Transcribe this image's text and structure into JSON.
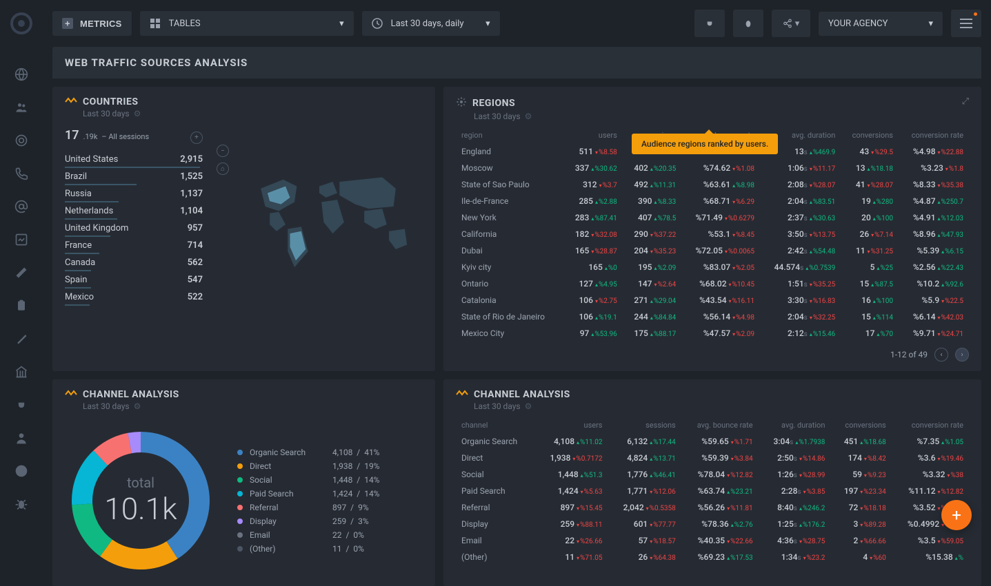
{
  "topbar": {
    "metrics": "METRICS",
    "tables": "TABLES",
    "daterange": "Last 30 days, daily",
    "agency": "YOUR AGENCY"
  },
  "title": "WEB TRAFFIC SOURCES ANALYSIS",
  "tooltip": "Audience regions ranked by users.",
  "countries": {
    "title": "COUNTRIES",
    "sub": "Last 30 days",
    "total_big": "17",
    "total_sm": ".19k",
    "total_label": "– All sessions",
    "rows": [
      {
        "name": "United States",
        "val": "2,915",
        "w": "98%"
      },
      {
        "name": "Brazil",
        "val": "1,525",
        "w": "52%"
      },
      {
        "name": "Russia",
        "val": "1,137",
        "w": "39%"
      },
      {
        "name": "Netherlands",
        "val": "1,104",
        "w": "38%"
      },
      {
        "name": "United Kingdom",
        "val": "957",
        "w": "33%"
      },
      {
        "name": "France",
        "val": "714",
        "w": "25%"
      },
      {
        "name": "Canada",
        "val": "562",
        "w": "19%"
      },
      {
        "name": "Spain",
        "val": "547",
        "w": "19%"
      },
      {
        "name": "Mexico",
        "val": "522",
        "w": "18%"
      }
    ]
  },
  "regions": {
    "title": "REGIONS",
    "sub": "Last 30 days",
    "headers": [
      "region",
      "users",
      "sessions",
      "bounce rate",
      "avg. duration",
      "conversions",
      "conversion rate"
    ],
    "rows": [
      {
        "name": "England",
        "users": "511",
        "ud": "%8.58",
        "udir": "down",
        "sess": "",
        "sd": "",
        "sdir": "",
        "br": "",
        "brd": "",
        "brdir": "",
        "dur": "13",
        "durs": "s",
        "durd": "%469.9",
        "durdir": "up",
        "conv": "43",
        "convd": "%29.5",
        "convdir": "down",
        "cr": "%4.98",
        "crd": "%22.88",
        "crdir": "down"
      },
      {
        "name": "Moscow",
        "users": "337",
        "ud": "%30.62",
        "udir": "up",
        "sess": "402",
        "sd": "%20.35",
        "sdir": "up",
        "br": "%74.62",
        "brd": "%1.08",
        "brdir": "down",
        "dur": "1:06",
        "durs": "s",
        "durd": "%11.17",
        "durdir": "down",
        "conv": "13",
        "convd": "%18.18",
        "convdir": "up",
        "cr": "%3.23",
        "crd": "%1.8",
        "crdir": "down"
      },
      {
        "name": "State of Sao Paulo",
        "users": "312",
        "ud": "%3.7",
        "udir": "down",
        "sess": "492",
        "sd": "%11.31",
        "sdir": "up",
        "br": "%63.61",
        "brd": "%8.98",
        "brdir": "up",
        "dur": "2:08",
        "durs": "s",
        "durd": "%28.07",
        "durdir": "down",
        "conv": "41",
        "convd": "%28.07",
        "convdir": "down",
        "cr": "%8.33",
        "crd": "%35.38",
        "crdir": "down"
      },
      {
        "name": "Ile-de-France",
        "users": "285",
        "ud": "%2.88",
        "udir": "up",
        "sess": "390",
        "sd": "%8.33",
        "sdir": "up",
        "br": "%68.71",
        "brd": "%6.29",
        "brdir": "down",
        "dur": "2:04",
        "durs": "s",
        "durd": "%83.51",
        "durdir": "up",
        "conv": "19",
        "convd": "%280",
        "convdir": "up",
        "cr": "%4.87",
        "crd": "%250.7",
        "crdir": "up"
      },
      {
        "name": "New York",
        "users": "283",
        "ud": "%87.41",
        "udir": "up",
        "sess": "407",
        "sd": "%78.5",
        "sdir": "up",
        "br": "%71.49",
        "brd": "%0.6279",
        "brdir": "down",
        "dur": "2:37",
        "durs": "s",
        "durd": "%30.63",
        "durdir": "up",
        "conv": "20",
        "convd": "%100",
        "convdir": "up",
        "cr": "%4.91",
        "crd": "%12.03",
        "crdir": "up"
      },
      {
        "name": "California",
        "users": "182",
        "ud": "%32.08",
        "udir": "down",
        "sess": "290",
        "sd": "%37.22",
        "sdir": "down",
        "br": "%53.1",
        "brd": "%8.45",
        "brdir": "down",
        "dur": "3:50",
        "durs": "s",
        "durd": "%13.75",
        "durdir": "down",
        "conv": "26",
        "convd": "%7.14",
        "convdir": "down",
        "cr": "%8.96",
        "crd": "%47.93",
        "crdir": "up"
      },
      {
        "name": "Dubai",
        "users": "165",
        "ud": "%28.87",
        "udir": "down",
        "sess": "204",
        "sd": "%35.23",
        "sdir": "down",
        "br": "%72.05",
        "brd": "%0.0065",
        "brdir": "down",
        "dur": "2:42",
        "durs": "s",
        "durd": "%54.48",
        "durdir": "up",
        "conv": "11",
        "convd": "%31.25",
        "convdir": "down",
        "cr": "%5.39",
        "crd": "%6.15",
        "crdir": "up"
      },
      {
        "name": "Kyiv city",
        "users": "165",
        "ud": "%0",
        "udir": "up",
        "sess": "195",
        "sd": "%2.09",
        "sdir": "up",
        "br": "%83.07",
        "brd": "%2.05",
        "brdir": "down",
        "dur": "44.574",
        "durs": "s",
        "durd": "%0.7539",
        "durdir": "up",
        "conv": "5",
        "convd": "%25",
        "convdir": "up",
        "cr": "%2.56",
        "crd": "%22.43",
        "crdir": "up"
      },
      {
        "name": "Ontario",
        "users": "127",
        "ud": "%4.95",
        "udir": "up",
        "sess": "147",
        "sd": "%2.64",
        "sdir": "down",
        "br": "%68.02",
        "brd": "%10.45",
        "brdir": "down",
        "dur": "1:51",
        "durs": "s",
        "durd": "%35.25",
        "durdir": "down",
        "conv": "15",
        "convd": "%87.5",
        "convdir": "up",
        "cr": "%10.2",
        "crd": "%92.6",
        "crdir": "up"
      },
      {
        "name": "Catalonia",
        "users": "106",
        "ud": "%2.75",
        "udir": "down",
        "sess": "271",
        "sd": "%29.04",
        "sdir": "up",
        "br": "%43.54",
        "brd": "%16.11",
        "brdir": "down",
        "dur": "3:30",
        "durs": "s",
        "durd": "%16.83",
        "durdir": "down",
        "conv": "16",
        "convd": "%100",
        "convdir": "up",
        "cr": "%5.9",
        "crd": "%22.5",
        "crdir": "down"
      },
      {
        "name": "State of Rio de Janeiro",
        "users": "106",
        "ud": "%19.1",
        "udir": "up",
        "sess": "244",
        "sd": "%84.84",
        "sdir": "up",
        "br": "%56.14",
        "brd": "%4.98",
        "brdir": "down",
        "dur": "2:04",
        "durs": "s",
        "durd": "%32.25",
        "durdir": "down",
        "conv": "15",
        "convd": "%114",
        "convdir": "up",
        "cr": "%6.14",
        "crd": "%42.03",
        "crdir": "down"
      },
      {
        "name": "Mexico City",
        "users": "97",
        "ud": "%53.96",
        "udir": "up",
        "sess": "175",
        "sd": "%88.17",
        "sdir": "up",
        "br": "%47.57",
        "brd": "%2.09",
        "brdir": "down",
        "dur": "2:12",
        "durs": "s",
        "durd": "%15.46",
        "durdir": "up",
        "conv": "17",
        "convd": "%70",
        "convdir": "up",
        "cr": "%9.71",
        "crd": "%24.71",
        "crdir": "down"
      }
    ],
    "pagination": "1-12 of 49"
  },
  "channel_donut": {
    "title": "CHANNEL ANALYSIS",
    "sub": "Last 30 days",
    "total_label": "total",
    "total": "10.1k",
    "legend": [
      {
        "name": "Organic Search",
        "val": "4,108",
        "pct": "41%",
        "color": "#3b82c4"
      },
      {
        "name": "Direct",
        "val": "1,938",
        "pct": "19%",
        "color": "#f59e0b"
      },
      {
        "name": "Social",
        "val": "1,448",
        "pct": "14%",
        "color": "#10b981"
      },
      {
        "name": "Paid Search",
        "val": "1,424",
        "pct": "14%",
        "color": "#06b6d4"
      },
      {
        "name": "Referral",
        "val": "897",
        "pct": "9%",
        "color": "#f87171"
      },
      {
        "name": "Display",
        "val": "259",
        "pct": "3%",
        "color": "#a78bfa"
      },
      {
        "name": "Email",
        "val": "22",
        "pct": "0%",
        "color": "#6b7280"
      },
      {
        "name": "(Other)",
        "val": "11",
        "pct": "0%",
        "color": "#4b5563"
      }
    ]
  },
  "channel_table": {
    "title": "CHANNEL ANALYSIS",
    "sub": "Last 30 days",
    "headers": [
      "channel",
      "users",
      "sessions",
      "avg. bounce rate",
      "avg. duration",
      "conversions",
      "conversion rate"
    ],
    "rows": [
      {
        "name": "Organic Search",
        "users": "4,108",
        "ud": "%11.02",
        "udir": "up",
        "sess": "6,132",
        "sd": "%17.44",
        "sdir": "up",
        "br": "%59.65",
        "brd": "%1.71",
        "brdir": "down",
        "dur": "3:04",
        "durs": "s",
        "durd": "%1.7938",
        "durdir": "up",
        "conv": "451",
        "convd": "%18.68",
        "convdir": "up",
        "cr": "%7.35",
        "crd": "%1.05",
        "crdir": "up"
      },
      {
        "name": "Direct",
        "users": "1,938",
        "ud": "%0.7172",
        "udir": "down",
        "sess": "4,824",
        "sd": "%13.71",
        "sdir": "up",
        "br": "%59.39",
        "brd": "%3.84",
        "brdir": "down",
        "dur": "2:50",
        "durs": "s",
        "durd": "%14.86",
        "durdir": "down",
        "conv": "174",
        "convd": "%8.42",
        "convdir": "down",
        "cr": "%3.6",
        "crd": "%19.46",
        "crdir": "down"
      },
      {
        "name": "Social",
        "users": "1,448",
        "ud": "%51.3",
        "udir": "up",
        "sess": "1,776",
        "sd": "%46.41",
        "sdir": "up",
        "br": "%78.04",
        "brd": "%12.82",
        "brdir": "down",
        "dur": "1:26",
        "durs": "s",
        "durd": "%28.99",
        "durdir": "down",
        "conv": "59",
        "convd": "%9.23",
        "convdir": "down",
        "cr": "%3.32",
        "crd": "%38",
        "crdir": "down"
      },
      {
        "name": "Paid Search",
        "users": "1,424",
        "ud": "%5.63",
        "udir": "down",
        "sess": "1,771",
        "sd": "%12.06",
        "sdir": "down",
        "br": "%63.74",
        "brd": "%23.21",
        "brdir": "up",
        "dur": "2:28",
        "durs": "s",
        "durd": "%3.85",
        "durdir": "down",
        "conv": "197",
        "convd": "%23.34",
        "convdir": "down",
        "cr": "%11.12",
        "crd": "%12.82",
        "crdir": "down"
      },
      {
        "name": "Referral",
        "users": "897",
        "ud": "%15.45",
        "udir": "down",
        "sess": "2,042",
        "sd": "%0.5358",
        "sdir": "down",
        "br": "%56.26",
        "brd": "%11.81",
        "brdir": "down",
        "dur": "8:40",
        "durs": "s",
        "durd": "%246.2",
        "durdir": "up",
        "conv": "72",
        "convd": "%18.18",
        "convdir": "down",
        "cr": "%3.52",
        "crd": "%17.74",
        "crdir": "down"
      },
      {
        "name": "Display",
        "users": "259",
        "ud": "%88.11",
        "udir": "down",
        "sess": "601",
        "sd": "%77.77",
        "sdir": "down",
        "br": "%78.36",
        "brd": "%2.76",
        "brdir": "up",
        "dur": "1:25",
        "durs": "s",
        "durd": "%176.2",
        "durdir": "up",
        "conv": "3",
        "convd": "%89.28",
        "convdir": "down",
        "cr": "%0.4992",
        "crd": "%51.8",
        "crdir": "down"
      },
      {
        "name": "Email",
        "users": "22",
        "ud": "%26.66",
        "udir": "down",
        "sess": "57",
        "sd": "%18.57",
        "sdir": "down",
        "br": "%40.35",
        "brd": "%22.66",
        "brdir": "down",
        "dur": "4:36",
        "durs": "s",
        "durd": "%28.75",
        "durdir": "down",
        "conv": "2",
        "convd": "%66.66",
        "convdir": "down",
        "cr": "%3.5",
        "crd": "%59.05",
        "crdir": "down"
      },
      {
        "name": "(Other)",
        "users": "11",
        "ud": "%71.05",
        "udir": "down",
        "sess": "26",
        "sd": "%64.38",
        "sdir": "down",
        "br": "%69.23",
        "brd": "%17.53",
        "brdir": "up",
        "dur": "1:34",
        "durs": "s",
        "durd": "%23.2",
        "durdir": "down",
        "conv": "4",
        "convd": "%60",
        "convdir": "down",
        "cr": "%15.38",
        "crd": "%",
        "crdir": "up"
      }
    ]
  },
  "chart_data": {
    "type": "pie",
    "title": "Channel Analysis",
    "total": 10107,
    "series": [
      {
        "name": "Organic Search",
        "value": 4108,
        "pct": 41,
        "color": "#3b82c4"
      },
      {
        "name": "Direct",
        "value": 1938,
        "pct": 19,
        "color": "#f59e0b"
      },
      {
        "name": "Social",
        "value": 1448,
        "pct": 14,
        "color": "#10b981"
      },
      {
        "name": "Paid Search",
        "value": 1424,
        "pct": 14,
        "color": "#06b6d4"
      },
      {
        "name": "Referral",
        "value": 897,
        "pct": 9,
        "color": "#f87171"
      },
      {
        "name": "Display",
        "value": 259,
        "pct": 3,
        "color": "#a78bfa"
      },
      {
        "name": "Email",
        "value": 22,
        "pct": 0,
        "color": "#6b7280"
      },
      {
        "name": "(Other)",
        "value": 11,
        "pct": 0,
        "color": "#4b5563"
      }
    ]
  }
}
